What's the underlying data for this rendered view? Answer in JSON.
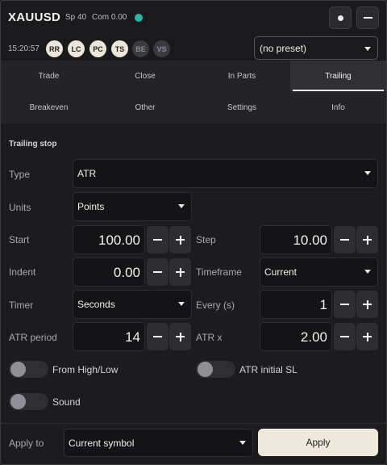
{
  "header": {
    "symbol": "XAUUSD",
    "spread": "Sp 40",
    "commission": "Com 0.00",
    "status_color": "#26b5a6",
    "time": "15:20:57",
    "chips": [
      {
        "label": "RR",
        "active": true
      },
      {
        "label": "LC",
        "active": true
      },
      {
        "label": "PC",
        "active": true
      },
      {
        "label": "TS",
        "active": true
      },
      {
        "label": "BE",
        "active": false
      },
      {
        "label": "VS",
        "active": false
      }
    ],
    "preset_value": "(no preset)",
    "buttons": {
      "dot_icon": "circle-icon",
      "minimize_icon": "minus-icon"
    }
  },
  "tabs": {
    "row1": [
      "Trade",
      "Close",
      "In Parts",
      "Trailing"
    ],
    "row2": [
      "Breakeven",
      "Other",
      "Settings",
      "Info"
    ],
    "active": "Trailing"
  },
  "trailing": {
    "section_title": "Trailing stop",
    "type_label": "Type",
    "type_value": "ATR",
    "units_label": "Units",
    "units_value": "Points",
    "start_label": "Start",
    "start_value": "100.00",
    "step_label": "Step",
    "step_value": "10.00",
    "indent_label": "Indent",
    "indent_value": "0.00",
    "timeframe_label": "Timeframe",
    "timeframe_value": "Current",
    "timer_label": "Timer",
    "timer_value": "Seconds",
    "every_label": "Every (s)",
    "every_value": "1",
    "atr_period_label": "ATR period",
    "atr_period_value": "14",
    "atr_x_label": "ATR x",
    "atr_x_value": "2.00",
    "from_high_low_label": "From High/Low",
    "from_high_low_on": false,
    "atr_initial_sl_label": "ATR initial SL",
    "atr_initial_sl_on": false,
    "sound_label": "Sound",
    "sound_on": false
  },
  "footer": {
    "apply_to_label": "Apply to",
    "apply_to_value": "Current symbol",
    "apply_button": "Apply",
    "apply_color": "#efe9dc"
  }
}
